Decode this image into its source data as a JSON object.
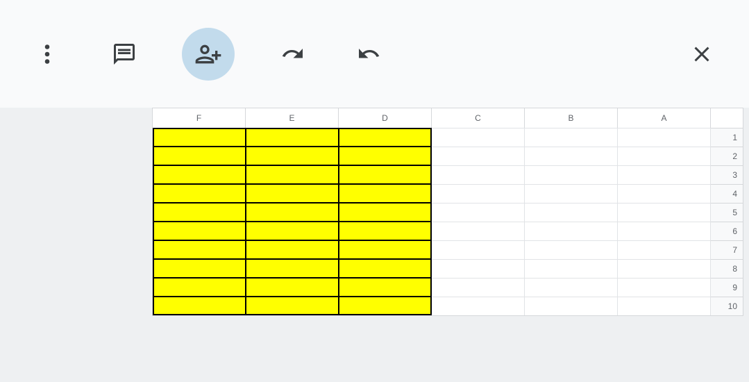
{
  "toolbar": {
    "more_icon": "more-vertical",
    "comment_icon": "comment",
    "add_person_icon": "person-add",
    "redo_icon": "redo",
    "undo_icon": "undo",
    "close_icon": "close"
  },
  "sheet": {
    "column_headers": [
      "F",
      "E",
      "D",
      "C",
      "B",
      "A"
    ],
    "row_headers": [
      "1",
      "2",
      "3",
      "4",
      "5",
      "6",
      "7",
      "8",
      "9",
      "10"
    ],
    "highlighted_columns": [
      "F",
      "E",
      "D"
    ],
    "highlighted_rows": [
      "1",
      "2",
      "3",
      "4",
      "5",
      "6",
      "7",
      "8",
      "9",
      "10"
    ],
    "highlight_fill": "#ffff00",
    "highlight_border": "#000000",
    "cells": {}
  }
}
